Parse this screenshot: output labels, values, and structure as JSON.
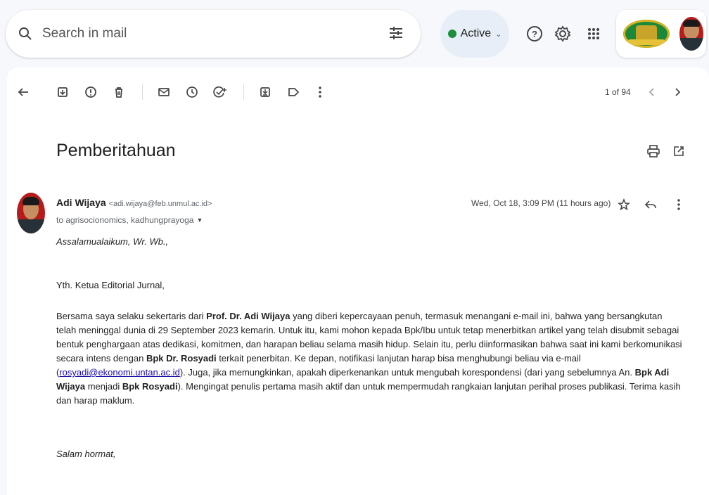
{
  "search": {
    "placeholder": "Search in mail",
    "value": ""
  },
  "status": {
    "label": "Active",
    "color": "#1e8e3e"
  },
  "icons": {
    "search": "search-icon",
    "tune": "tune-icon",
    "help": "help-icon",
    "settings": "gear-icon",
    "apps": "apps-grid-icon"
  },
  "toolbar": {
    "pager": "1 of 94"
  },
  "email": {
    "subject": "Pemberitahuan",
    "sender_name": "Adi Wijaya",
    "sender_email": "<adi.wijaya@feb.unmul.ac.id>",
    "to": "to agrisocionomics, kadhungprayoga",
    "date": "Wed, Oct 18, 3:09 PM (11 hours ago)",
    "greeting": "Assalamualaikum, Wr. Wb.,",
    "salute": "Yth. Ketua Editorial Jurnal,",
    "para": {
      "t1": "Bersama saya selaku sekertaris dari ",
      "b1": "Prof. Dr. Adi Wijaya",
      "t2": " yang diberi kepercayaan penuh, termasuk menangani e-mail ini, bahwa yang bersangkutan telah meninggal dunia di 29 September 2023 kemarin. Untuk itu, kami mohon kepada Bpk/Ibu untuk tetap menerbitkan artikel yang telah disubmit sebagai bentuk penghargaan atas dedikasi, komitmen, dan harapan beliau selama masih hidup. Selain itu, perlu diinformasikan bahwa saat ini kami berkomunikasi secara intens dengan ",
      "b2": "Bpk Dr. Rosyadi",
      "t3": " terkait penerbitan. Ke depan, notifikasi lanjutan harap bisa menghubungi beliau via e-mail (",
      "link": "rosyadi@ekonomi.untan.ac.id",
      "t4": "). Juga, jika memungkinkan, apakah diperkenankan untuk mengubah korespondensi (dari yang sebelumnya An. ",
      "b3": "Bpk Adi Wijaya",
      "t5": " menjadi ",
      "b4": "Bpk Rosyadi",
      "t6": "). Mengingat penulis pertama masih aktif dan untuk mempermudah rangkaian lanjutan perihal proses publikasi. Terima kasih dan harap maklum."
    },
    "closing": "Salam hormat,"
  }
}
